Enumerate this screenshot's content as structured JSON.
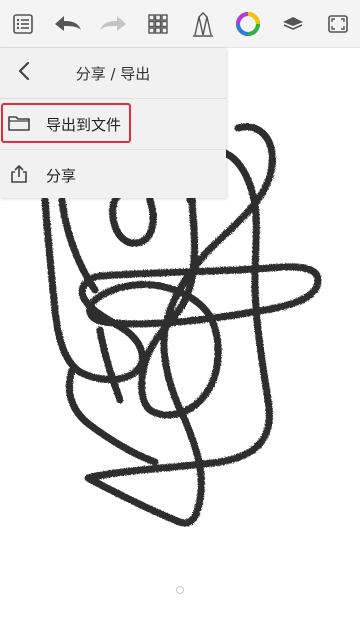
{
  "toolbar": {
    "icons": [
      "list-icon",
      "undo-icon",
      "redo-icon",
      "grid-icon",
      "brush-icon",
      "color-wheel-icon",
      "layers-icon",
      "fullscreen-icon"
    ]
  },
  "panel": {
    "title": "分享 / 导出",
    "items": [
      {
        "label": "导出到文件",
        "icon": "folder-icon",
        "highlighted": true
      },
      {
        "label": "分享",
        "icon": "share-icon",
        "highlighted": false
      }
    ]
  },
  "colors": {
    "accent_highlight": "#e0303a",
    "stroke": "#333333",
    "toolbar_bg": "#f4f4f4",
    "panel_bg": "#f1f1f1"
  }
}
